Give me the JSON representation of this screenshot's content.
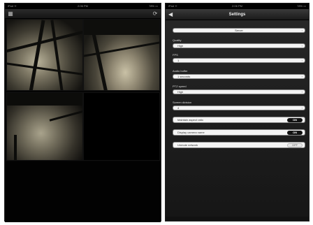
{
  "left_tablet": {
    "status": {
      "carrier": "iPad ᯤ",
      "time": "2:06 PM",
      "battery": "78% ▭"
    },
    "toolbar": {
      "left_icon": "grid-icon",
      "right_icon": "refresh-icon"
    }
  },
  "right_tablet": {
    "status": {
      "carrier": "iPad ᯤ",
      "time": "2:06 PM",
      "battery": "78% ▭"
    },
    "nav": {
      "back_glyph": "◀",
      "title": "Settings"
    },
    "server_field": "Server",
    "quality": {
      "label": "Quality",
      "value": "High"
    },
    "fps": {
      "label": "FPS",
      "value": "1"
    },
    "audio_buffer": {
      "label": "Audio buffer",
      "value": "1 seconds"
    },
    "ptz_speed": {
      "label": "PTZ speed",
      "value": "High"
    },
    "screen_division": {
      "label": "Screen division",
      "value": "4"
    },
    "toggles": [
      {
        "label": "Maintain aspect ratio",
        "state": "ON"
      },
      {
        "label": "Display camera name",
        "state": "ON"
      },
      {
        "label": "Unmute network",
        "state": "OFF"
      }
    ]
  },
  "colors": {
    "accent": "#000000",
    "field_bg": "#f4f4f4"
  }
}
